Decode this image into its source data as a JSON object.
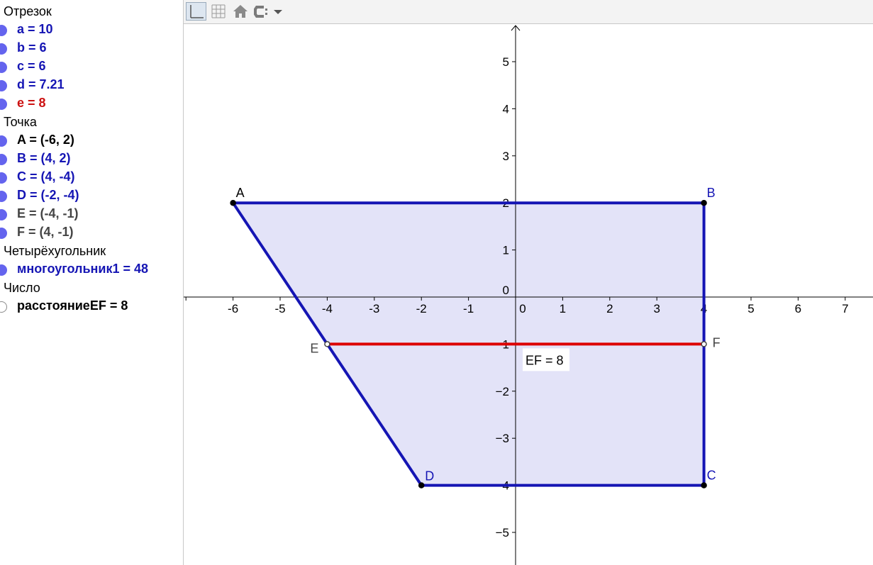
{
  "algebra": {
    "categories": {
      "segment": "Отрезок",
      "point": "Точка",
      "quadrilateral": "Четырёхугольник",
      "number": "Число"
    },
    "segments": [
      {
        "text": "a = 10",
        "color": "#1515b4"
      },
      {
        "text": "b = 6",
        "color": "#1515b4"
      },
      {
        "text": "c = 6",
        "color": "#1515b4"
      },
      {
        "text": "d = 7.21",
        "color": "#1515b4"
      },
      {
        "text": "e = 8",
        "color": "#cc1111"
      }
    ],
    "points": [
      {
        "text": "A = (-6, 2)",
        "color": "#000000"
      },
      {
        "text": "B = (4, 2)",
        "color": "#1515b4"
      },
      {
        "text": "C = (4, -4)",
        "color": "#1515b4"
      },
      {
        "text": "D = (-2, -4)",
        "color": "#1515b4"
      },
      {
        "text": "E = (-4, -1)",
        "color": "#444444"
      },
      {
        "text": "F = (4, -1)",
        "color": "#444444"
      }
    ],
    "polygons": [
      {
        "text": "многоугольник1 = 48",
        "color": "#1515b4"
      }
    ],
    "numbers": [
      {
        "text": "расстояниеEF = 8",
        "color": "#000000"
      }
    ]
  },
  "toolbar": {
    "icons": [
      "axes-toggle-icon",
      "grid-toggle-icon",
      "home-icon",
      "point-capture-icon",
      "dropdown-arrow-icon"
    ]
  },
  "graphics": {
    "x_ticks": [
      "-6",
      "-5",
      "-4",
      "-3",
      "-2",
      "-1",
      "0",
      "1",
      "2",
      "3",
      "4",
      "5",
      "6",
      "7"
    ],
    "y_ticks": [
      "5",
      "4",
      "3",
      "2",
      "1",
      "0",
      "−1",
      "−2",
      "−3",
      "−4",
      "−5"
    ],
    "points": {
      "A": {
        "label": "A",
        "x": -6,
        "y": 2,
        "color": "#000000"
      },
      "B": {
        "label": "B",
        "x": 4,
        "y": 2,
        "color": "#1515b4"
      },
      "C": {
        "label": "C",
        "x": 4,
        "y": -4,
        "color": "#1515b4"
      },
      "D": {
        "label": "D",
        "x": -2,
        "y": -4,
        "color": "#1515b4"
      },
      "E": {
        "label": "E",
        "x": -4,
        "y": -1,
        "color": "#444444"
      },
      "F": {
        "label": "F",
        "x": 4,
        "y": -1,
        "color": "#444444"
      }
    },
    "polygon_vertices": [
      "A",
      "B",
      "C",
      "D"
    ],
    "polygon_color": "#1515b4",
    "polygon_fill": "#e3e3f8",
    "segment_ef_color": "#dd0000",
    "ef_label": "EF = 8"
  }
}
